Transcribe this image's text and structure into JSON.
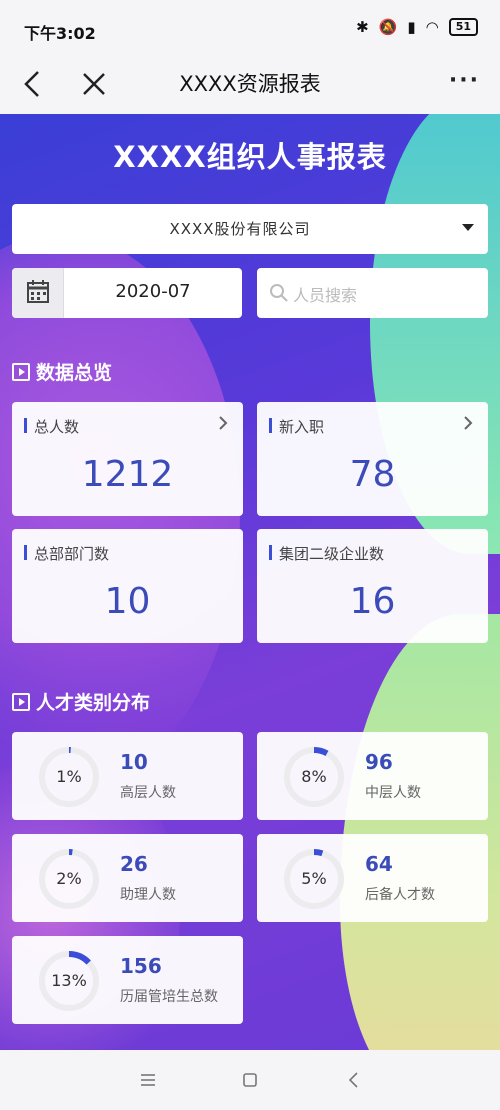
{
  "status_bar": {
    "time": "下午3:02",
    "battery": "51"
  },
  "nav": {
    "title": "XXXX资源报表",
    "more": "···"
  },
  "page": {
    "title": "XXXX组织人事报表"
  },
  "filters": {
    "company": "XXXX股份有限公司",
    "date": "2020-07",
    "search_placeholder": "人员搜索"
  },
  "overview": {
    "heading": "数据总览",
    "cards": [
      {
        "label": "总人数",
        "value": "1212"
      },
      {
        "label": "新入职",
        "value": "78"
      },
      {
        "label": "总部部门数",
        "value": "10"
      },
      {
        "label": "集团二级企业数",
        "value": "16"
      }
    ]
  },
  "talent": {
    "heading": "人才类别分布",
    "cards": [
      {
        "pct": "1%",
        "pct_value": 1,
        "value": "10",
        "label": "高层人数"
      },
      {
        "pct": "8%",
        "pct_value": 8,
        "value": "96",
        "label": "中层人数"
      },
      {
        "pct": "2%",
        "pct_value": 2,
        "value": "26",
        "label": "助理人数"
      },
      {
        "pct": "5%",
        "pct_value": 5,
        "value": "64",
        "label": "后备人才数"
      },
      {
        "pct": "13%",
        "pct_value": 13,
        "value": "156",
        "label": "历届管培生总数"
      }
    ]
  },
  "colors": {
    "accent": "#3b4bb8",
    "ring_track": "#ececef",
    "ring_fill": "#3b4ed6"
  }
}
